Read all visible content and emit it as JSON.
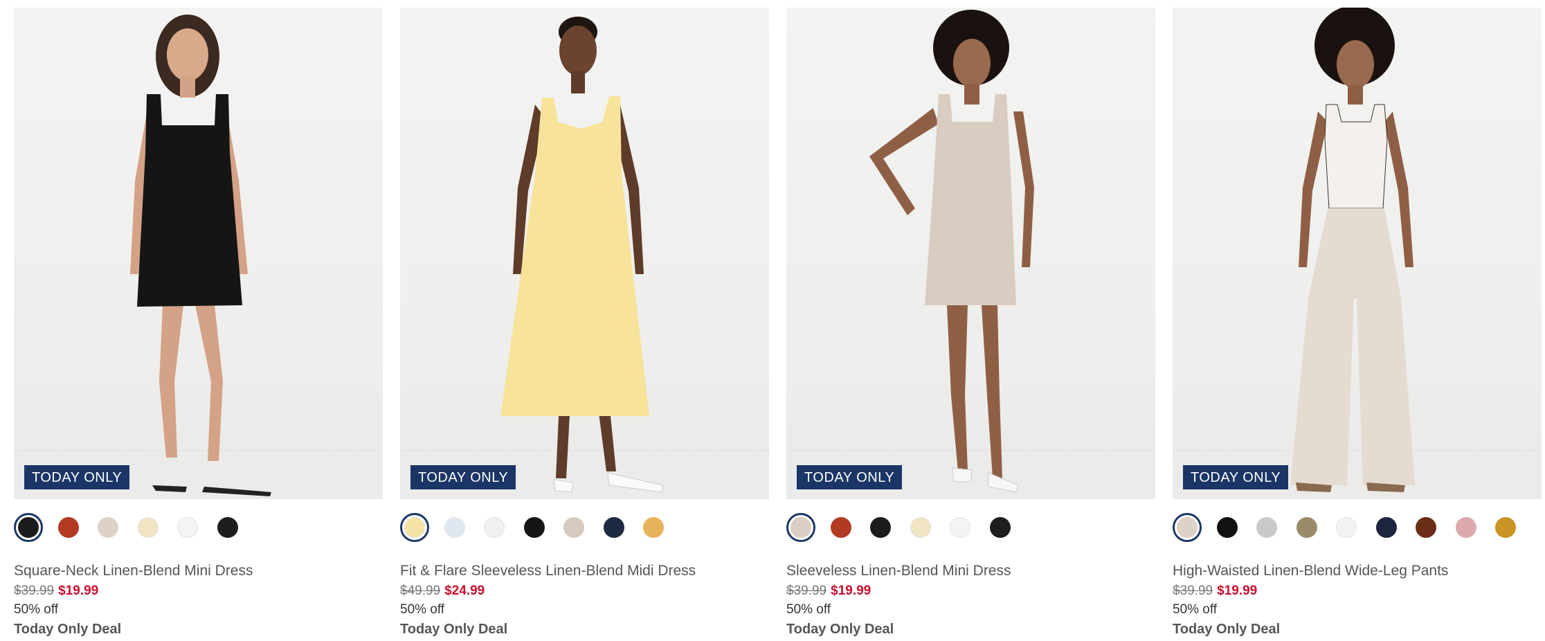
{
  "products": [
    {
      "name": "Square-Neck Linen-Blend Mini Dress",
      "badge": "TODAY ONLY",
      "original_price": "$39.99",
      "sale_price": "$19.99",
      "discount": "50% off",
      "deal": "Today Only Deal",
      "swatches": [
        "#1c1c1e",
        "#b23a22",
        "#dcd2c8",
        "#f1e4c2",
        "#f4f4f2",
        "#1e1e1e"
      ],
      "garment_color": "#151515",
      "hair_color": "#3a2a20"
    },
    {
      "name": "Fit & Flare Sleeveless Linen-Blend Midi Dress",
      "badge": "TODAY ONLY",
      "original_price": "$49.99",
      "sale_price": "$24.99",
      "discount": "50% off",
      "deal": "Today Only Deal",
      "swatches": [
        "#f6e3a4",
        "#dfe7f0",
        "#f1f1ef",
        "#151515",
        "#d6c9bd",
        "#1d2a44",
        "#e8b25a"
      ],
      "garment_color": "#f7e39a",
      "hair_color": "#1e1510"
    },
    {
      "name": "Sleeveless Linen-Blend Mini Dress",
      "badge": "TODAY ONLY",
      "original_price": "$39.99",
      "sale_price": "$19.99",
      "discount": "50% off",
      "deal": "Today Only Deal",
      "swatches": [
        "#dccdc2",
        "#b23a22",
        "#1c1c1e",
        "#f1e4c2",
        "#f4f4f2",
        "#1e1e1e"
      ],
      "garment_color": "#d9ccc0",
      "hair_color": "#1a1210"
    },
    {
      "name": "High-Waisted Linen-Blend Wide-Leg Pants",
      "badge": "TODAY ONLY",
      "original_price": "$39.99",
      "sale_price": "$19.99",
      "discount": "50% off",
      "deal": "Today Only Deal",
      "swatches": [
        "#ddd2c8",
        "#111111",
        "#c9c9c9",
        "#9a8c68",
        "#f3f3f1",
        "#1d2540",
        "#6a2e16",
        "#dca9ad",
        "#c99423"
      ],
      "garment_color": "#e4dbd1",
      "hair_color": "#1a1210"
    }
  ]
}
